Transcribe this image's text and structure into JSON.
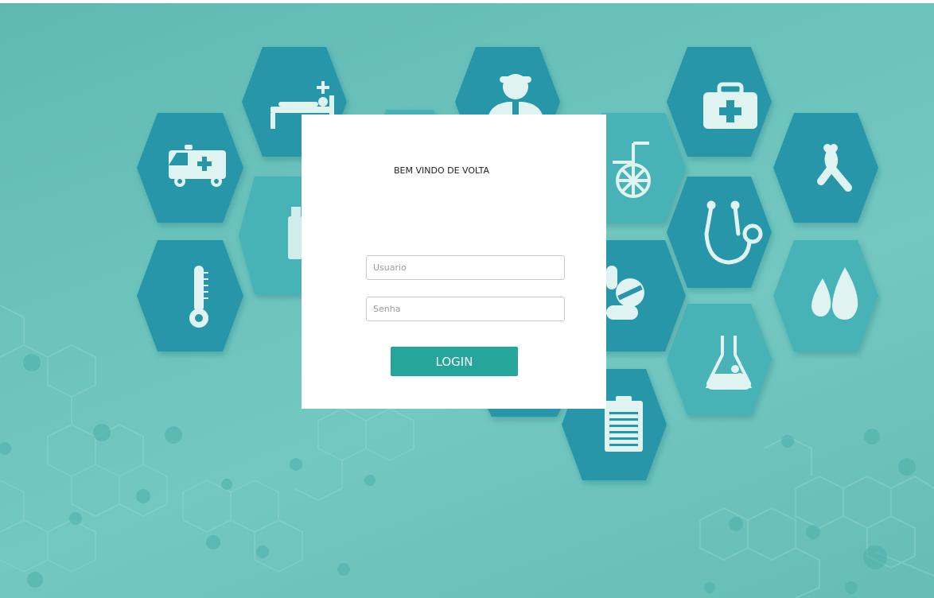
{
  "login": {
    "welcome_text": "BEM VINDO DE VOLTA",
    "username_placeholder": "Usuario",
    "password_placeholder": "Senha",
    "login_label": "LOGIN"
  },
  "background": {
    "icons": [
      "ambulance-icon",
      "hospital-bed-icon",
      "doctor-icon",
      "medical-kit-icon",
      "ribbon-icon",
      "thermometer-icon",
      "medicine-bottle-icon",
      "wheelchair-icon",
      "stethoscope-icon",
      "pills-icon",
      "drops-icon",
      "flask-icon",
      "clipboard-icon"
    ],
    "colors": {
      "hex_dark": "#2696a8",
      "hex_light": "#47b3b6",
      "page_bg": "#6cc3bc",
      "button": "#26a69a"
    }
  }
}
